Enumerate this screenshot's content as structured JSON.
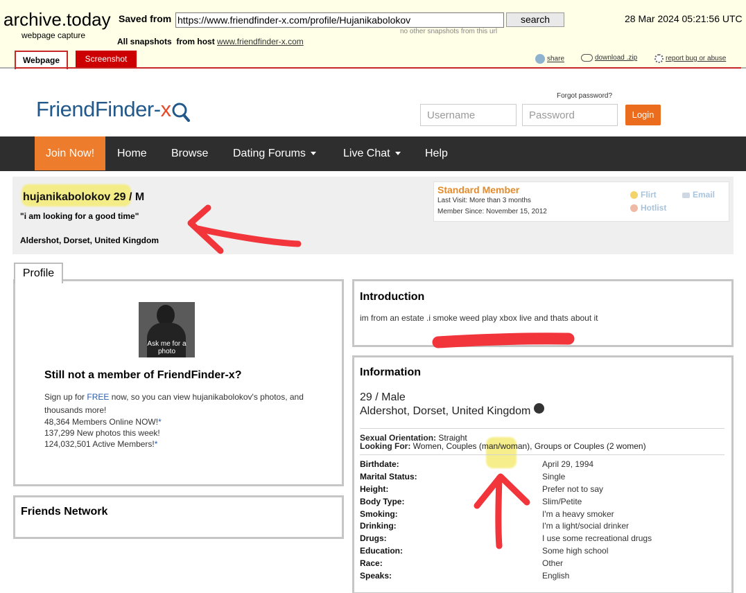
{
  "archive": {
    "title": "archive.today",
    "subtitle": "webpage capture",
    "saved_from_label": "Saved from",
    "url": "https://www.friendfinder-x.com/profile/Hujanikabolokov",
    "search_label": "search",
    "no_other": "no other snapshots from this url",
    "date": "28 Mar 2024 05:21:56 UTC",
    "all_snapshots_label": "All snapshots",
    "from_host_label": "from host",
    "host": "www.friendfinder-x.com",
    "tab_webpage": "Webpage",
    "tab_screenshot": "Screenshot",
    "share": "share",
    "download": "download .zip",
    "report": "report bug or abuse"
  },
  "site": {
    "logo_main": "FriendFinder-",
    "logo_x": "x",
    "forgot": "Forgot password?",
    "username_placeholder": "Username",
    "password_placeholder": "Password",
    "login": "Login",
    "nav": {
      "join": "Join Now!",
      "home": "Home",
      "browse": "Browse",
      "forums": "Dating Forums",
      "chat": "Live Chat",
      "help": "Help"
    }
  },
  "profile": {
    "username": "hujanikabolokov",
    "age_sex": "29 / M",
    "quote": "\"i am looking for a good time\"",
    "location": "Aldershot, Dorset, United Kingdom",
    "member_type": "Standard Member",
    "last_visit": "Last Visit: More than 3 months",
    "member_since": "Member Since: November 15, 2012",
    "flirt": "Flirt",
    "email": "Email",
    "hotlist": "Hotlist"
  },
  "left": {
    "profile_tab": "Profile",
    "photo_caption": "Ask me for a photo",
    "still_title": "Still not a member of FriendFinder-x?",
    "signup_pre": "Sign up for",
    "signup_free": "FREE",
    "signup_post": "now, so you can view hujanikabolokov's photos, and thousands more!",
    "stats": [
      {
        "text": "48,364 Members Online NOW!",
        "star": "*"
      },
      {
        "text": "137,299 New photos this week!",
        "star": ""
      },
      {
        "text": "124,032,501 Active Members!",
        "star": "*"
      }
    ],
    "friends_title": "Friends Network"
  },
  "intro": {
    "title": "Introduction",
    "text": "im from an estate .i smoke weed play xbox live and thats about it"
  },
  "info": {
    "title": "Information",
    "age_sex": "29 / Male",
    "location": "Aldershot, Dorset, United Kingdom",
    "orientation_label": "Sexual Orientation:",
    "orientation": "Straight",
    "looking_label": "Looking For:",
    "looking": "Women, Couples (man/woman), Groups or Couples (2 women)",
    "details": [
      {
        "label": "Birthdate:",
        "value": "April 29, 1994"
      },
      {
        "label": "Marital Status:",
        "value": "Single"
      },
      {
        "label": "Height:",
        "value": "Prefer not to say"
      },
      {
        "label": "Body Type:",
        "value": "Slim/Petite"
      },
      {
        "label": "Smoking:",
        "value": "I'm a heavy smoker"
      },
      {
        "label": "Drinking:",
        "value": "I'm a light/social drinker"
      },
      {
        "label": "Drugs:",
        "value": "I use some recreational drugs"
      },
      {
        "label": "Education:",
        "value": "Some high school"
      },
      {
        "label": "Race:",
        "value": "Other"
      },
      {
        "label": "Speaks:",
        "value": "English"
      }
    ]
  },
  "colors": {
    "accent": "#ed7c2c",
    "nav_bg": "#2e2e2e",
    "member": "#e38b2c",
    "annotation_red": "#f2343b",
    "highlight": "#f4ec76"
  }
}
